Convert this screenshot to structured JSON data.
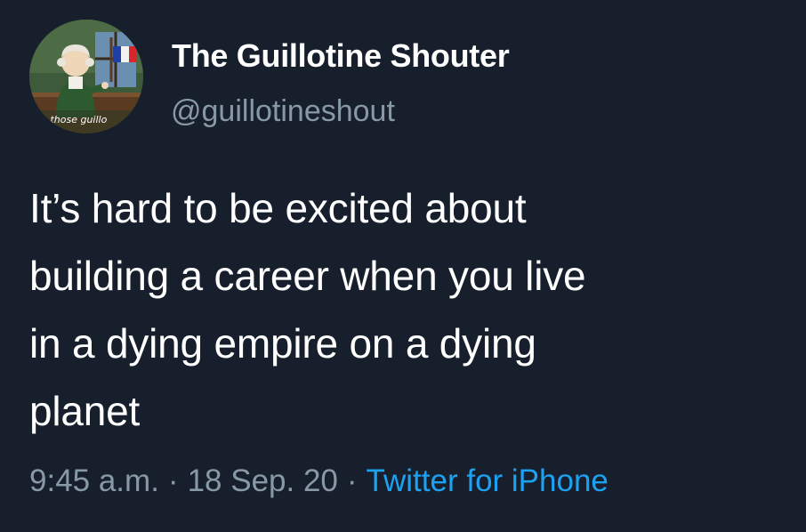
{
  "profile": {
    "display_name": "The Guillotine Shouter",
    "handle": "@guillotineshout",
    "avatar_caption": "up those guillo"
  },
  "tweet": {
    "text_lines": [
      "It’s hard to be excited about",
      "building a career when you live",
      "in a dying empire on a dying",
      "planet"
    ]
  },
  "meta": {
    "time": "9:45 a.m.",
    "separator": "·",
    "date": "18 Sep. 20",
    "source": "Twitter for iPhone"
  },
  "colors": {
    "background": "#161f2b",
    "text": "#ffffff",
    "secondary": "#8899a6",
    "link": "#1da1f2"
  }
}
